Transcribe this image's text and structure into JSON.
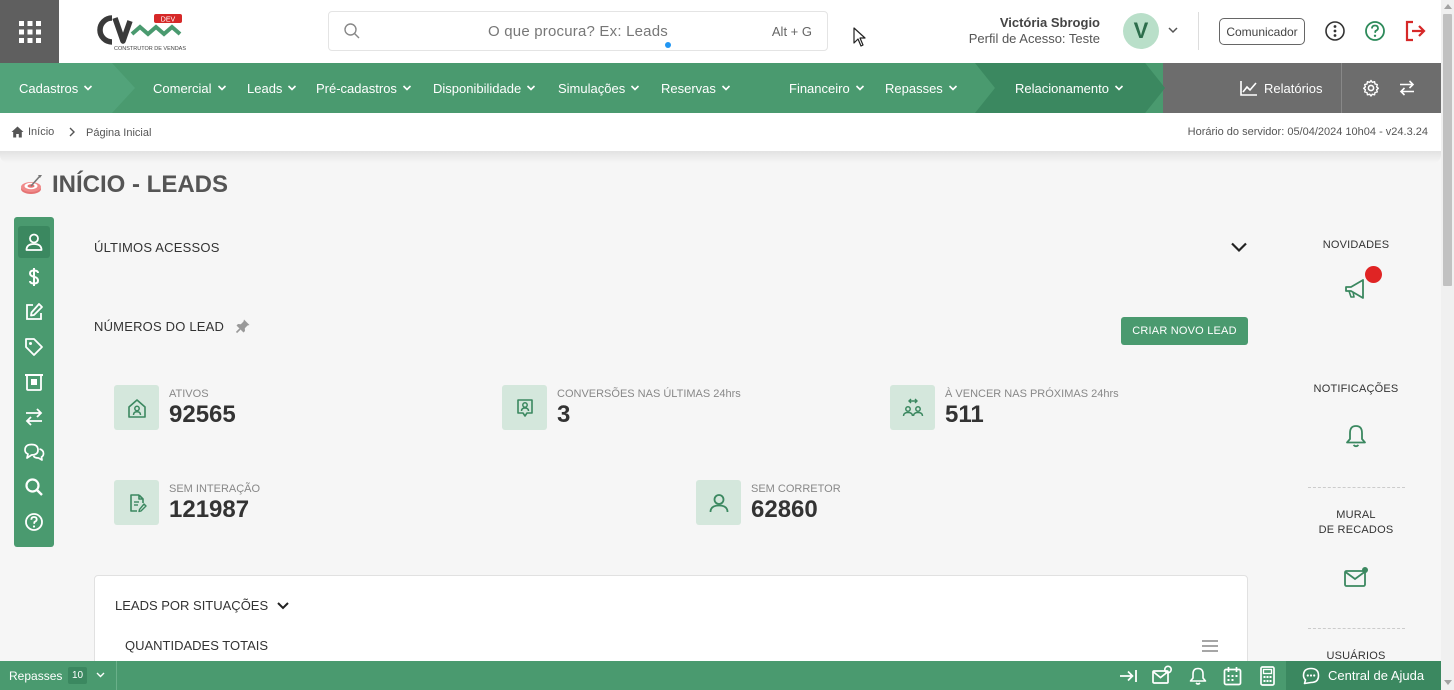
{
  "header": {
    "search_placeholder": "O que procura? Ex: Leads",
    "search_hint": "Alt + G",
    "user_name": "Victória Sbrogio",
    "user_profile": "Perfil de Acesso: Teste",
    "avatar_letter": "V",
    "comunicador_label": "Comunicador",
    "logo_badge": "DEV",
    "logo_sub": "CONSTRUTOR DE VENDAS"
  },
  "nav": {
    "cadastros": "Cadastros",
    "comercial": "Comercial",
    "leads": "Leads",
    "pre_cadastros": "Pré-cadastros",
    "disponibilidade": "Disponibilidade",
    "simulacoes": "Simulações",
    "reservas": "Reservas",
    "financeiro": "Financeiro",
    "repasses": "Repasses",
    "relacionamento": "Relacionamento",
    "relatorios": "Relatórios"
  },
  "breadcrumb": {
    "home": "Início",
    "page": "Página Inicial",
    "server_time": "Horário do servidor: 05/04/2024 10h04 - v24.3.24"
  },
  "page": {
    "title": "INÍCIO - LEADS"
  },
  "sections": {
    "ultimos_acessos": "ÚLTIMOS ACESSOS",
    "numeros_lead": "NÚMEROS DO LEAD",
    "criar_lead": "CRIAR NOVO LEAD",
    "leads_por_situacoes": "LEADS POR SITUAÇÕES",
    "quantidades_totais": "QUANTIDADES TOTAIS"
  },
  "stats": [
    {
      "label": "ATIVOS",
      "value": "92565"
    },
    {
      "label": "CONVERSÕES NAS ÚLTIMAS 24hrs",
      "value": "3"
    },
    {
      "label": "À VENCER NAS PRÓXIMAS 24hrs",
      "value": "511"
    },
    {
      "label": "SEM INTERAÇÃO",
      "value": "121987"
    },
    {
      "label": "SEM CORRETOR",
      "value": "62860"
    }
  ],
  "right_column": {
    "novidades": "NOVIDADES",
    "notificacoes": "NOTIFICAÇÕES",
    "mural_line1": "MURAL",
    "mural_line2": "DE RECADOS",
    "usuarios": "USUÁRIOS"
  },
  "footer": {
    "label": "Repasses",
    "count": "10",
    "central_ajuda": "Central de Ajuda"
  },
  "colors": {
    "brand_green": "#4a9a6f",
    "brand_dark_green": "#3b8860",
    "icon_bg": "#d4e7dc",
    "alert_red": "#e02424"
  }
}
